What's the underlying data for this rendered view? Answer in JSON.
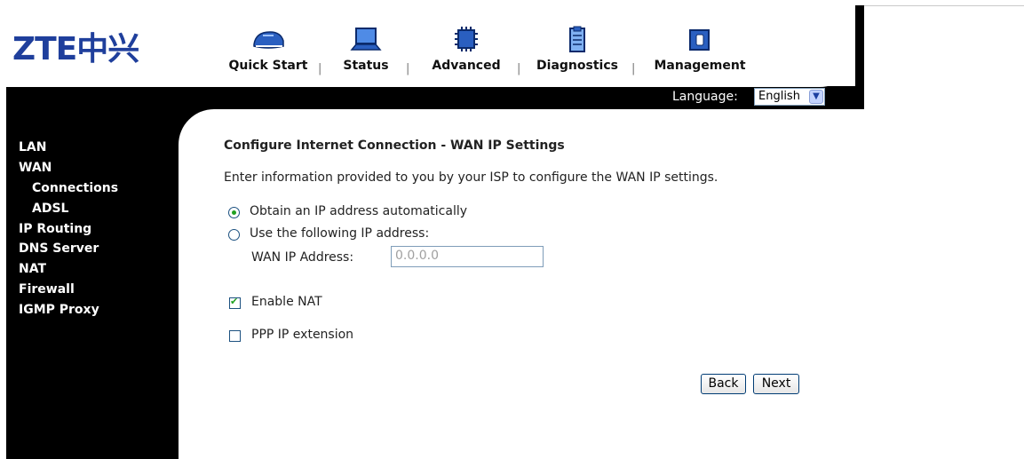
{
  "brand": {
    "logo": "ZTE中兴"
  },
  "nav": {
    "items": [
      {
        "label": "Quick Start",
        "icon": "sneaker-icon"
      },
      {
        "label": "Status",
        "icon": "laptop-icon"
      },
      {
        "label": "Advanced",
        "icon": "chip-icon"
      },
      {
        "label": "Diagnostics",
        "icon": "clipboard-icon"
      },
      {
        "label": "Management",
        "icon": "folder-icon"
      }
    ],
    "separator": "|"
  },
  "language": {
    "label": "Language:",
    "selected": "English"
  },
  "sidebar": {
    "items": [
      {
        "label": "LAN",
        "level": 0
      },
      {
        "label": "WAN",
        "level": 0
      },
      {
        "label": "Connections",
        "level": 1
      },
      {
        "label": "ADSL",
        "level": 1
      },
      {
        "label": "IP Routing",
        "level": 0
      },
      {
        "label": "DNS Server",
        "level": 0
      },
      {
        "label": "NAT",
        "level": 0
      },
      {
        "label": "Firewall",
        "level": 0
      },
      {
        "label": "IGMP Proxy",
        "level": 0
      }
    ]
  },
  "main": {
    "title": "Configure Internet Connection - WAN IP Settings",
    "description": "Enter information provided to you by your ISP to configure the WAN IP settings.",
    "radio_auto": {
      "label": "Obtain an IP address automatically",
      "checked": true
    },
    "radio_manual": {
      "label": "Use the following IP address:",
      "checked": false
    },
    "wan_ip": {
      "label": "WAN IP Address:",
      "value": "0.0.0.0"
    },
    "enable_nat": {
      "label": "Enable NAT",
      "checked": true
    },
    "ppp_ip_ext": {
      "label": "PPP IP extension",
      "checked": false
    },
    "back_label": "Back",
    "next_label": "Next"
  },
  "colors": {
    "brand_blue": "#1f3f9c",
    "sidebar_bg": "#000000",
    "check_green": "#21a121"
  }
}
